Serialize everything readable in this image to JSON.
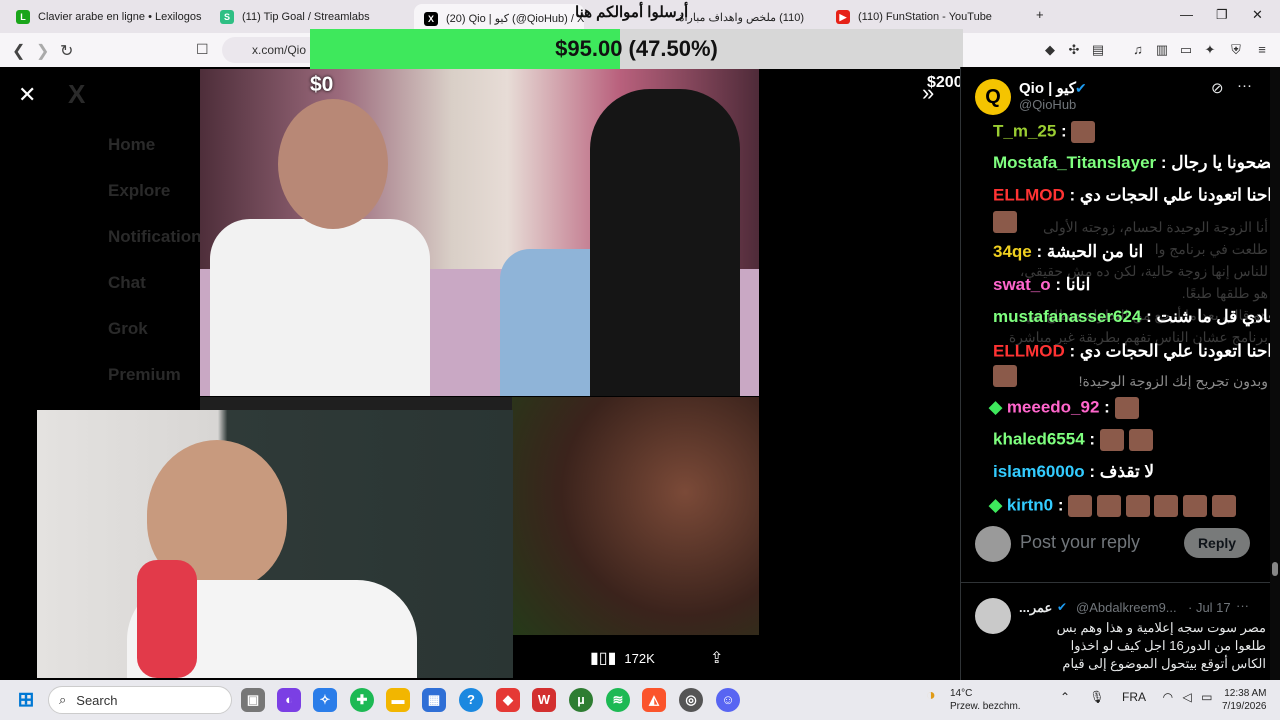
{
  "browser": {
    "tabs": [
      {
        "title": "Clavier arabe en ligne • Lexilogos",
        "favicon_color": "#1aa51a",
        "favicon_glyph": "L"
      },
      {
        "title": "(11) Tip Goal / Streamlabs",
        "favicon_color": "#2fbf84",
        "favicon_glyph": "S"
      },
      {
        "title": "(20) Qio | كيو (@QioHub) / X",
        "favicon_color": "#000000",
        "favicon_glyph": "X"
      },
      {
        "title": "(110) ملخص واهداف مباراة",
        "favicon_color": "#e62117",
        "favicon_glyph": "▶"
      },
      {
        "title": "(110) FunStation - YouTube",
        "favicon_color": "#e62117",
        "favicon_glyph": "▶"
      }
    ],
    "url": "x.com/Qio",
    "extension_badge": "1"
  },
  "goal_overlay": {
    "title": "أرسلوا أموالكم هنا",
    "amount_text": "$95.00 (47.50%)",
    "progress_fraction": 0.475,
    "min_label": "$0",
    "max_label": "$200",
    "fill_color": "#3ee85c"
  },
  "x_sidebar_dim": [
    "Home",
    "Explore",
    "Notifications",
    "Chat",
    "Grok",
    "Premium"
  ],
  "media": {
    "views": "172K"
  },
  "profile": {
    "name": "Qio | كيو",
    "handle": "@QioHub"
  },
  "chat": [
    {
      "user": "T_m_25",
      "color": "#9acd32",
      "msg": "",
      "emotes": 1
    },
    {
      "user": "Mostafa_Titanslayer",
      "color": "#7fff7f",
      "msg": "فضحونا يا رجال",
      "emotes": 0
    },
    {
      "user": "ELLMOD",
      "color": "#ff3333",
      "msg": "احنا اتعودنا علي الحجات دي",
      "emotes": 2
    },
    {
      "user": "34qe",
      "color": "#f0d020",
      "msg": "انا من الحبشة",
      "emotes": 0
    },
    {
      "user": "swat_o",
      "color": "#ff66cc",
      "msg": "انانا",
      "emotes": 0
    },
    {
      "user": "mustafanasser624",
      "color": "#7fff7f",
      "msg": "عادي قل ما شنت",
      "emotes": 0
    },
    {
      "user": "ELLMOD",
      "color": "#ff3333",
      "msg": "احنا اتعودنا علي الحجات دي",
      "emotes": 2
    },
    {
      "user": "meeedo_92",
      "color": "#ff66cc",
      "msg": "",
      "emotes": 1
    },
    {
      "user": "khaled6554",
      "color": "#7fff7f",
      "msg": "",
      "emotes": 2
    },
    {
      "user": "islam6000o",
      "color": "#33ccff",
      "msg": "لا تقذف",
      "emotes": 0
    },
    {
      "user": "kirtn0",
      "color": "#33ccff",
      "msg": "",
      "emotes": 6
    }
  ],
  "tweet_dim_text": [
    "أنا الزوجة الوحيدة لحسام، زوجته الأولى",
    "طلعت في برنامج وا",
    "للناس إنها زوجة حالية، لكن ده مش حقيقي،",
    "هو طلقها طبعًا.",
    "هو قالي بعد ما أرجع من البطولة هنطلع في",
    "برنامج عشان الناس تفهم بطريقة غير مباشرة",
    "وبدون تجريح إنك الزوجة الوحيدة!"
  ],
  "reply": {
    "placeholder": "Post your reply",
    "button": "Reply"
  },
  "reply_tweet": {
    "name": "...عمر",
    "handle": "@Abdalkreem9...",
    "date": "· Jul 17",
    "lines": [
      "مصر سوت سجه إعلامية و هذا وهم بس",
      "طلعوا من الدور16 اجل كيف لو اخذوا",
      "الكاس أتوقع بيتحول الموضوع إلى قيام"
    ]
  },
  "taskbar": {
    "search_label": "Search",
    "weather_temp": "14°C",
    "weather_desc": "Przew. bezchm.",
    "lang": "FRA",
    "time": "12:38 AM",
    "date": "7/19/2026"
  }
}
